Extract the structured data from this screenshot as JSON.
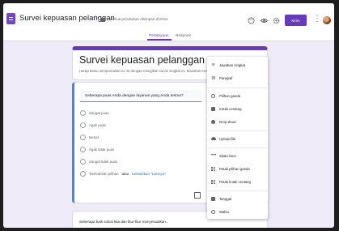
{
  "topbar": {
    "title": "Survei kepuasan pelanggan",
    "saved_status": "Semua perubahan disimpan di Drive",
    "send_label": "Kirim",
    "icons": [
      "palette-icon",
      "eye-icon",
      "gear-icon",
      "more-icon"
    ]
  },
  "tabs": [
    {
      "label": "Pertanyaan",
      "active": true
    },
    {
      "label": "Respons",
      "active": false
    }
  ],
  "form": {
    "title": "Survei kepuasan pelanggan",
    "description": "Harap bantu sempurnakan ini 42 dengan mengikuti survei singkat ini. Masukan Anda"
  },
  "question": {
    "text": "Seberapa puas Anda dengan layanan yang Anda terima?",
    "options": [
      "Sangat puas",
      "Agak puas",
      "Netral",
      "Agak tidak puas",
      "Sangat tidak puas"
    ],
    "add_option": "Tambahkan pilihan",
    "or": "atau",
    "add_other": "tambahkan \"Lainnya\""
  },
  "next_question": {
    "text": "Seberapa baik solusi kita dan fitur-fitur menyesuaikan..."
  },
  "menu": {
    "items": [
      {
        "label": "Jawaban singkat",
        "icon": "short-answer-icon"
      },
      {
        "label": "Paragraf",
        "icon": "paragraph-icon"
      },
      {
        "label": "Pilihan ganda",
        "icon": "radio-icon"
      },
      {
        "label": "Kotak centang",
        "icon": "checkbox-icon"
      },
      {
        "label": "Drop-down",
        "icon": "dropdown-icon"
      },
      {
        "label": "Upload file",
        "icon": "cloud-upload-icon"
      },
      {
        "label": "Skala linier",
        "icon": "linear-scale-icon"
      },
      {
        "label": "Petak pilihan ganda",
        "icon": "grid-icon"
      },
      {
        "label": "Petak kotak centang",
        "icon": "grid-check-icon"
      },
      {
        "label": "Tanggal",
        "icon": "calendar-icon"
      },
      {
        "label": "Waktu",
        "icon": "clock-icon"
      }
    ]
  },
  "colors": {
    "accent": "#673ab7",
    "background": "#f0ebf8",
    "link": "#1a73e8",
    "focus": "#4285f4"
  }
}
